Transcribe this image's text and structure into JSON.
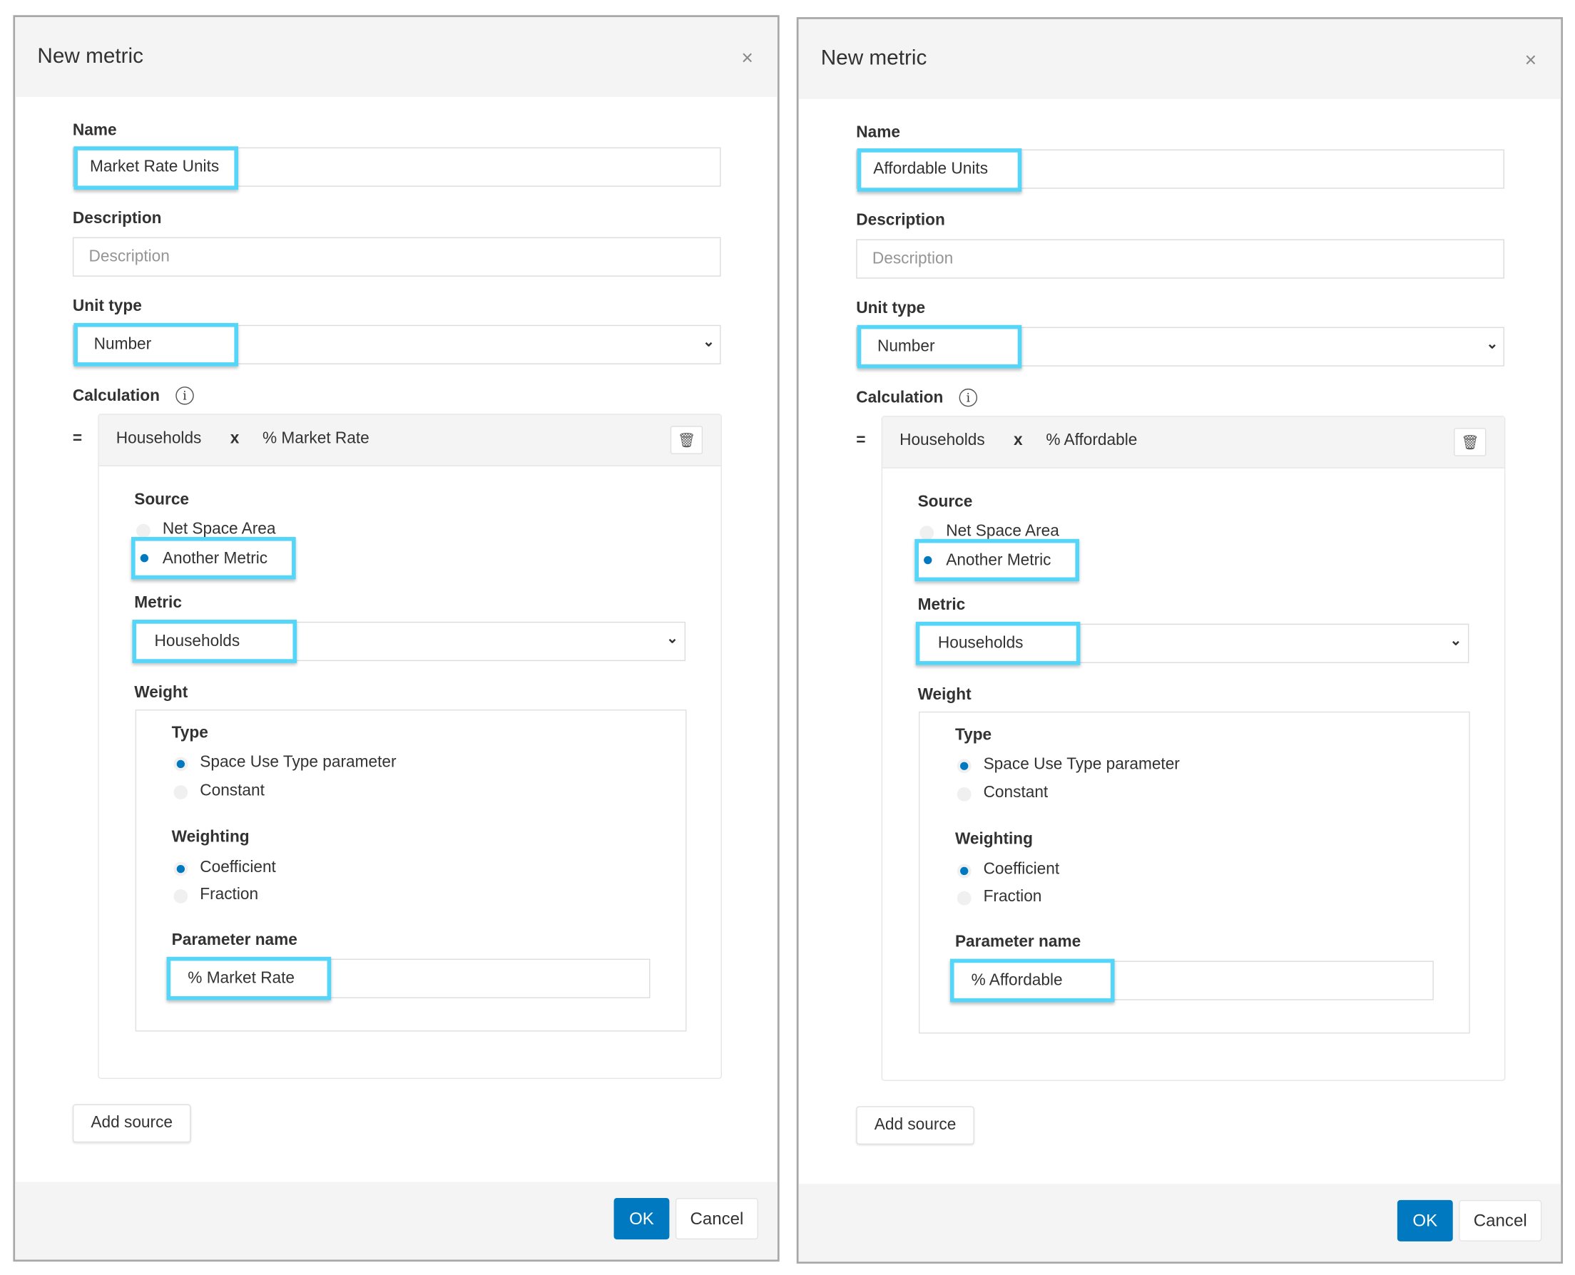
{
  "dialogs": [
    {
      "title": "New metric",
      "close_icon": "×",
      "name_label": "Name",
      "name_value": "Market Rate Units",
      "description_label": "Description",
      "description_placeholder": "Description",
      "unit_type_label": "Unit type",
      "unit_type_value": "Number",
      "calculation_label": "Calculation",
      "equals": "=",
      "calc_terms": [
        "Households",
        "x",
        "% Market Rate"
      ],
      "source_label": "Source",
      "source_options": [
        "Net Space Area",
        "Another Metric"
      ],
      "source_selected": 1,
      "metric_label": "Metric",
      "metric_value": "Households",
      "weight_label": "Weight",
      "type_label": "Type",
      "type_options": [
        "Space Use Type parameter",
        "Constant"
      ],
      "type_selected": 0,
      "weighting_label": "Weighting",
      "weighting_options": [
        "Coefficient",
        "Fraction"
      ],
      "weighting_selected": 0,
      "parameter_name_label": "Parameter name",
      "parameter_name_value": "% Market Rate",
      "add_source": "Add source",
      "ok": "OK",
      "cancel": "Cancel"
    },
    {
      "title": "New metric",
      "close_icon": "×",
      "name_label": "Name",
      "name_value": "Affordable Units",
      "description_label": "Description",
      "description_placeholder": "Description",
      "unit_type_label": "Unit type",
      "unit_type_value": "Number",
      "calculation_label": "Calculation",
      "equals": "=",
      "calc_terms": [
        "Households",
        "x",
        "% Affordable"
      ],
      "source_label": "Source",
      "source_options": [
        "Net Space Area",
        "Another Metric"
      ],
      "source_selected": 1,
      "metric_label": "Metric",
      "metric_value": "Households",
      "weight_label": "Weight",
      "type_label": "Type",
      "type_options": [
        "Space Use Type parameter",
        "Constant"
      ],
      "type_selected": 0,
      "weighting_label": "Weighting",
      "weighting_options": [
        "Coefficient",
        "Fraction"
      ],
      "weighting_selected": 0,
      "parameter_name_label": "Parameter name",
      "parameter_name_value": "% Affordable",
      "add_source": "Add source",
      "ok": "OK",
      "cancel": "Cancel"
    }
  ],
  "colors": {
    "highlight": "#55d5f8",
    "primary": "#0079c1"
  }
}
